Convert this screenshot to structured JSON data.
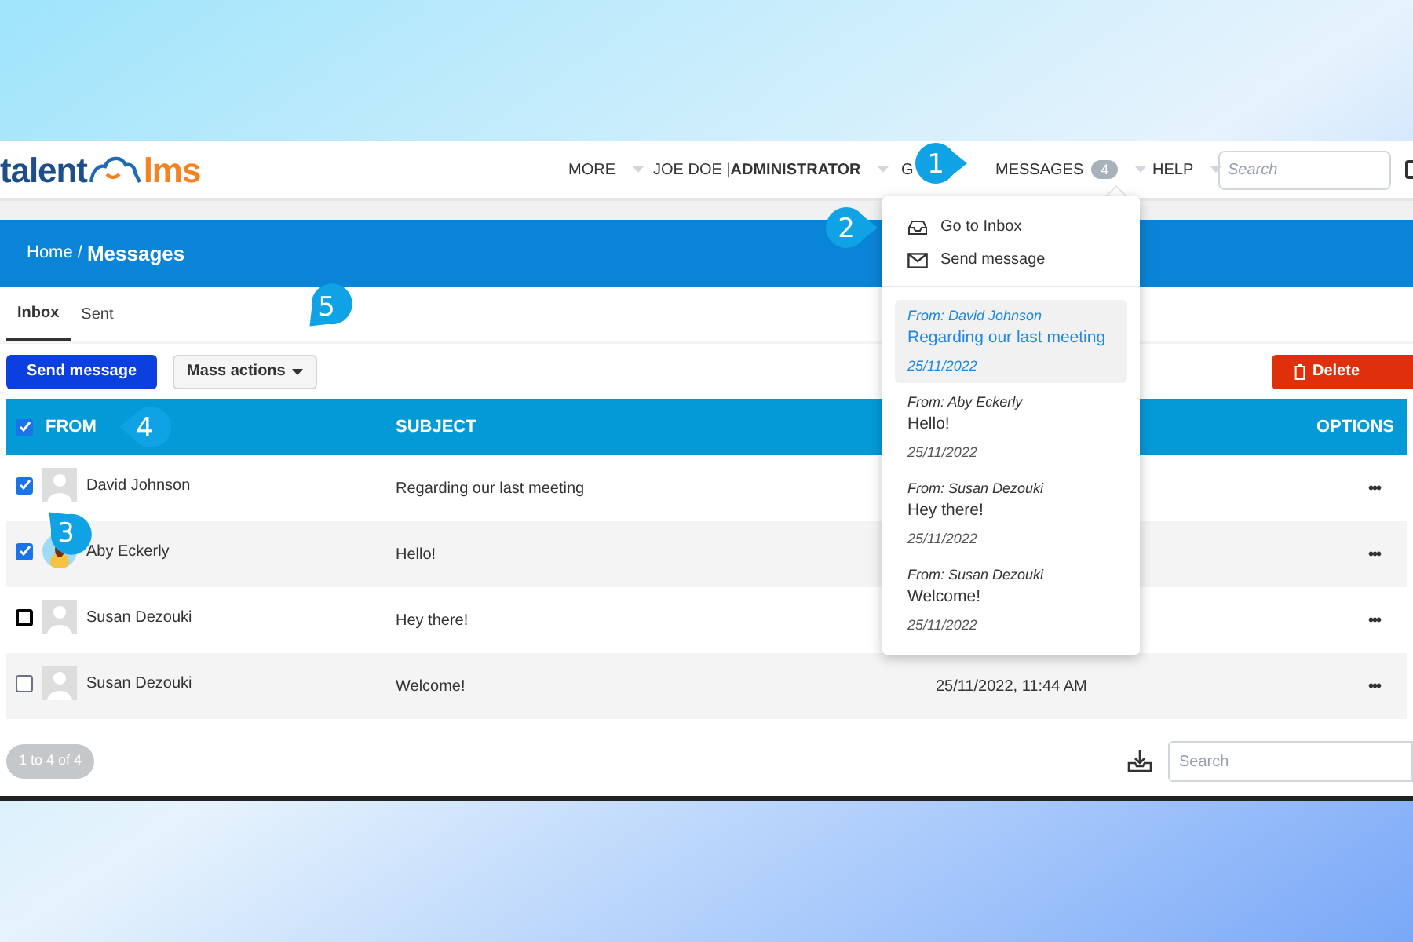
{
  "logo": {
    "left": "talent",
    "right": "lms"
  },
  "nav": [
    {
      "label": "MORE",
      "caret": true
    },
    {
      "label": "JOE DOE | ",
      "bold": "ADMINISTRATOR",
      "caret": true
    },
    {
      "label": "G",
      "caret": false
    },
    {
      "label": "MESSAGES",
      "badge": "4",
      "caret": true
    },
    {
      "label": "HELP",
      "caret": true
    }
  ],
  "header_search": {
    "placeholder": "Search"
  },
  "breadcrumb": {
    "parent": "Home /",
    "current": "Messages"
  },
  "tabs": [
    {
      "label": "Inbox",
      "selected": true
    },
    {
      "label": "Sent",
      "selected": false
    }
  ],
  "toolbar": {
    "send": "Send message",
    "mass": "Mass actions",
    "delete": "Delete"
  },
  "table": {
    "columns": [
      "FROM",
      "SUBJECT",
      "OPTIONS"
    ],
    "all_checked": true,
    "rows": [
      {
        "checked": true,
        "from": "David Johnson",
        "avatar": {
          "kind": "silhouette"
        },
        "subject": "Regarding our last meeting",
        "date": "",
        "options": "•••"
      },
      {
        "checked": true,
        "from": "Aby Eckerly",
        "avatar": {
          "kind": "picture"
        },
        "subject": "Hello!",
        "date": "",
        "options": "•••"
      },
      {
        "checked": false,
        "from": "Susan Dezouki",
        "avatar": {
          "kind": "silhouette"
        },
        "subject": "Hey there!",
        "date": "",
        "options": "•••"
      },
      {
        "checked": false,
        "from": "Susan Dezouki",
        "avatar": {
          "kind": "silhouette"
        },
        "subject": "Welcome!",
        "date": "25/11/2022, 11:44 AM",
        "options": "•••"
      }
    ]
  },
  "pagination": "1 to 4 of 4",
  "footer_search": {
    "placeholder": "Search"
  },
  "dropdown": {
    "actions": [
      {
        "kind": "inbox",
        "label": "Go to Inbox"
      },
      {
        "kind": "send",
        "label": "Send message"
      }
    ],
    "messages": [
      {
        "from": "From: David Johnson",
        "subject": "Regarding our last meeting",
        "date": "25/11/2022",
        "selected": true
      },
      {
        "from": "From: Aby Eckerly",
        "subject": "Hello!",
        "date": "25/11/2022",
        "selected": false
      },
      {
        "from": "From: Susan Dezouki",
        "subject": "Hey there!",
        "date": "25/11/2022",
        "selected": false
      },
      {
        "from": "From: Susan Dezouki",
        "subject": "Welcome!",
        "date": "25/11/2022",
        "selected": false
      }
    ]
  },
  "callouts": [
    "1",
    "2",
    "3",
    "4",
    "5"
  ]
}
